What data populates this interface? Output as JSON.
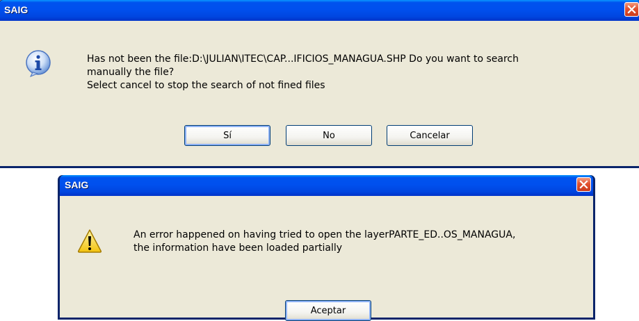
{
  "dialog_question": {
    "title": "SAIG",
    "icon": "information-icon",
    "message_lines": [
      "Has not been the file:D:\\JULIAN\\ITEC\\CAP...IFICIOS_MANAGUA.SHP Do you want to search",
      "manually the file?",
      "Select cancel to stop the search of not fined files"
    ],
    "buttons": {
      "yes": "Sí",
      "no": "No",
      "cancel": "Cancelar"
    }
  },
  "dialog_error": {
    "title": "SAIG",
    "icon": "warning-icon",
    "message_lines": [
      "An error happened on having tried to open the layerPARTE_ED..OS_MANAGUA,",
      "the information have been loaded partially"
    ],
    "buttons": {
      "ok": "Aceptar"
    }
  },
  "colors": {
    "titlebar": "#0053ee",
    "client": "#ece9d8",
    "close": "#e2512f"
  }
}
